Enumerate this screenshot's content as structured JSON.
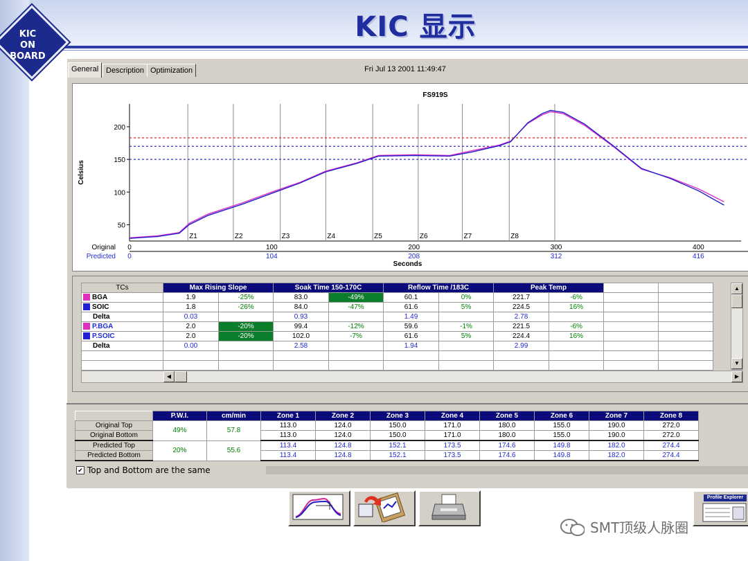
{
  "slide": {
    "title": "KIC 显示",
    "logo_text": [
      "KIC",
      "ON",
      "BOARD"
    ],
    "watermark": "SMT顶级人脉圈",
    "colors": {
      "title": "#1f2d9e",
      "accent": "#2e3fa8",
      "header_bg": "#0a0a7a",
      "highlight": "#0b7d2b"
    }
  },
  "tabs": [
    "General",
    "Description",
    "Optimization"
  ],
  "datetime": "Fri Jul 13 2001 11:49:47",
  "chart_data": {
    "type": "line",
    "title": "FS919S",
    "xlabel": "Seconds",
    "ylabel": "Celsius",
    "xlim": [
      0,
      430
    ],
    "ylim": [
      25,
      235
    ],
    "y_ticks": [
      50,
      100,
      150,
      200
    ],
    "x_ticks_original": {
      "label": "Original",
      "values": [
        0,
        100,
        200,
        300,
        400
      ]
    },
    "x_ticks_predicted": {
      "label": "Predicted",
      "values": [
        0,
        104,
        208,
        312,
        416
      ]
    },
    "zones": [
      {
        "label": "Z1",
        "x": 41
      },
      {
        "label": "Z2",
        "x": 73
      },
      {
        "label": "Z3",
        "x": 106
      },
      {
        "label": "Z4",
        "x": 138
      },
      {
        "label": "Z5",
        "x": 171
      },
      {
        "label": "Z6",
        "x": 203
      },
      {
        "label": "Z7",
        "x": 234
      },
      {
        "label": "Z8",
        "x": 267
      },
      {
        "label": "",
        "x": 299
      }
    ],
    "reference_lines": [
      {
        "y": 183,
        "color": "#e02020"
      },
      {
        "y": 170,
        "color": "#3030d0"
      },
      {
        "y": 150,
        "color": "#3030d0"
      }
    ],
    "series": [
      {
        "color": "#e030c0",
        "x": [
          0,
          20,
          35,
          42,
          55,
          80,
          100,
          120,
          138,
          160,
          175,
          200,
          225,
          240,
          260,
          268,
          280,
          290,
          296,
          305,
          320,
          340,
          360,
          380,
          400,
          418
        ],
        "y": [
          30,
          33,
          38,
          52,
          66,
          84,
          100,
          115,
          132,
          145,
          156,
          157,
          156,
          163,
          172,
          178,
          205,
          218,
          223,
          220,
          202,
          170,
          135,
          122,
          105,
          85
        ]
      },
      {
        "color": "#2020d0",
        "x": [
          0,
          20,
          35,
          42,
          55,
          80,
          100,
          120,
          138,
          160,
          175,
          200,
          225,
          240,
          260,
          268,
          280,
          290,
          296,
          305,
          320,
          340,
          360,
          380,
          400,
          418
        ],
        "y": [
          29,
          32,
          37,
          50,
          64,
          82,
          98,
          114,
          131,
          144,
          155,
          156,
          155,
          161,
          171,
          177,
          206,
          220,
          225,
          222,
          204,
          171,
          136,
          121,
          102,
          80
        ]
      }
    ]
  },
  "tc_grid": {
    "tc_header": "TCs",
    "groups": [
      "Max Rising Slope",
      "Soak Time 150-170C",
      "Reflow Time /183C",
      "Peak Temp"
    ],
    "rows": [
      {
        "name": "BGA",
        "swatch": "#e030c0",
        "cells": [
          "1.9",
          "-25%",
          "83.0",
          "-49%",
          "60.1",
          "0%",
          "221.7",
          "-6%"
        ],
        "hl": [
          3
        ]
      },
      {
        "name": "SOIC",
        "swatch": "#2020d0",
        "cells": [
          "1.8",
          "-26%",
          "84.0",
          "-47%",
          "61.6",
          "5%",
          "224.5",
          "16%"
        ],
        "hl": []
      },
      {
        "name": "Delta",
        "swatch": "",
        "cells": [
          "0.03",
          "",
          "0.93",
          "",
          "1.49",
          "",
          "2.78",
          ""
        ],
        "hl": [],
        "delta": true
      },
      {
        "name": "P.BGA",
        "swatch": "#e030c0",
        "cells": [
          "2.0",
          "-20%",
          "99.4",
          "-12%",
          "59.6",
          "-1%",
          "221.5",
          "-6%"
        ],
        "hl": [
          1
        ],
        "pred": true
      },
      {
        "name": "P.SOIC",
        "swatch": "#2020d0",
        "cells": [
          "2.0",
          "-20%",
          "102.0",
          "-7%",
          "61.6",
          "5%",
          "224.4",
          "16%"
        ],
        "hl": [
          1
        ],
        "pred": true
      },
      {
        "name": "Delta",
        "swatch": "",
        "cells": [
          "0.00",
          "",
          "2.58",
          "",
          "1.94",
          "",
          "2.99",
          ""
        ],
        "hl": [],
        "delta": true
      }
    ]
  },
  "zone_table": {
    "headers": [
      "P.W.I.",
      "cm/min",
      "Zone 1",
      "Zone 2",
      "Zone 3",
      "Zone 4",
      "Zone 5",
      "Zone 6",
      "Zone 7",
      "Zone 8"
    ],
    "original": {
      "labels": [
        "Original Top",
        "Original Bottom"
      ],
      "pwi": "49%",
      "speed": "57.8",
      "top": [
        "113.0",
        "124.0",
        "150.0",
        "171.0",
        "180.0",
        "155.0",
        "190.0",
        "272.0"
      ],
      "bottom": [
        "113.0",
        "124.0",
        "150.0",
        "171.0",
        "180.0",
        "155.0",
        "190.0",
        "272.0"
      ]
    },
    "predicted": {
      "labels": [
        "Predicted Top",
        "Predicted Bottom"
      ],
      "pwi": "20%",
      "speed": "55.6",
      "top": [
        "113.4",
        "124.8",
        "152.1",
        "173.5",
        "174.6",
        "149.8",
        "182.0",
        "274.4"
      ],
      "bottom": [
        "113.4",
        "124.8",
        "152.1",
        "173.5",
        "174.6",
        "149.8",
        "182.0",
        "274.4"
      ]
    },
    "checkbox_label": "Top and Bottom are the same",
    "checkbox_checked": true
  },
  "toolbar": {
    "explorer_label": "Profile Explorer"
  }
}
